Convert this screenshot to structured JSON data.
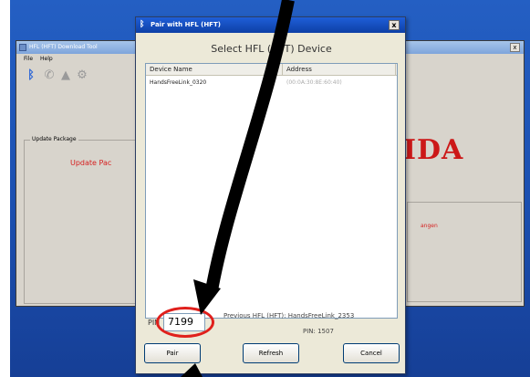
{
  "background_app": {
    "title": "HFL (HFT) Download Tool",
    "menu": [
      "File",
      "Help"
    ],
    "toolbar_icons": [
      "bluetooth-icon",
      "phone-icon",
      "lock-icon",
      "gear-icon"
    ],
    "group_label": "Update Package",
    "update_text": "Update Pac",
    "logo_text": "IDA",
    "right_text": "angen"
  },
  "dialog": {
    "title": "Pair with HFL (HFT)",
    "close_label": "x",
    "heading": "Select HFL (HFT) Device",
    "columns": [
      "Device Name",
      "Address"
    ],
    "rows": [
      {
        "name": "HandsFreeLink_0320",
        "address": "(00:0A:30:8E:60:40)"
      }
    ],
    "pin_label": "PIN",
    "pin_value": "7199",
    "previous_line": "Previous HFL (HFT): HandsFreeLink_2353",
    "previous_pin": "PIN: 1507",
    "buttons": {
      "pair": "Pair",
      "refresh": "Refresh",
      "cancel": "Cancel"
    }
  },
  "colors": {
    "desktop": "#1b4fb0",
    "dialog_title": "#0e3fa6",
    "highlight": "#e0201c",
    "logo": "#cc1818"
  }
}
